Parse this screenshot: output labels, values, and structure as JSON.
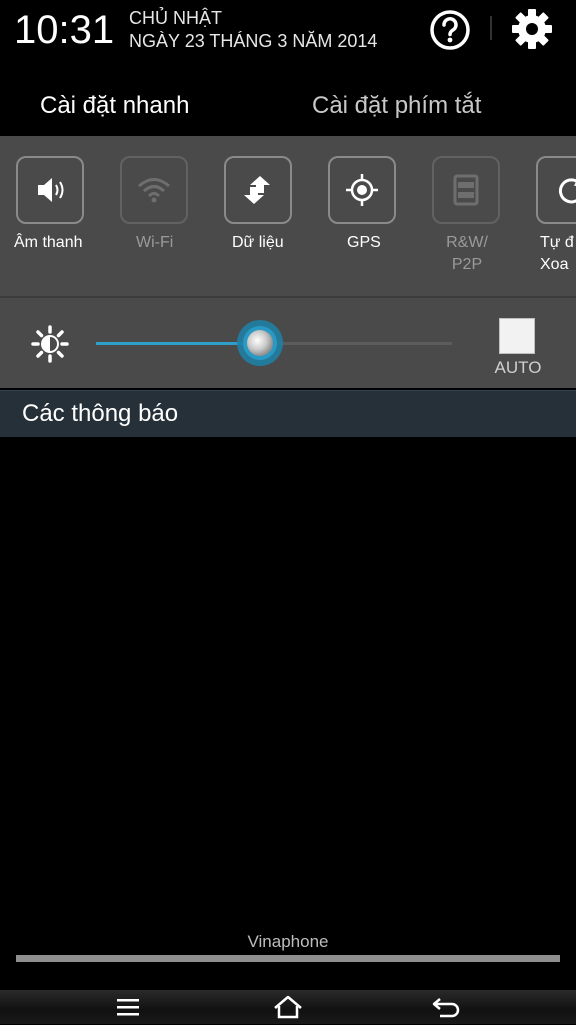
{
  "status": {
    "time": "10:31",
    "day": "CHỦ NHẬT",
    "date": "NGÀY 23 THÁNG 3 NĂM 2014",
    "help_icon": "help-circle-icon",
    "settings_icon": "gear-icon"
  },
  "tabs": [
    {
      "label": "Cài đặt nhanh",
      "active": true
    },
    {
      "label": "Cài đặt phím tắt",
      "active": false
    }
  ],
  "quick_settings": [
    {
      "label": "Âm thanh",
      "icon": "speaker-icon",
      "enabled": true
    },
    {
      "label": "Wi-Fi",
      "icon": "wifi-icon",
      "enabled": false
    },
    {
      "label": "Dữ liệu",
      "icon": "data-transfer-icon",
      "enabled": true
    },
    {
      "label": "GPS",
      "icon": "gps-icon",
      "enabled": true
    },
    {
      "label": "R&W/\nP2P",
      "icon": "rw-p2p-icon",
      "enabled": false
    },
    {
      "label": "Tự đ\nXoa",
      "icon": "rotate-icon",
      "enabled": true
    }
  ],
  "brightness": {
    "icon": "brightness-icon",
    "level": 0.46,
    "auto_label": "AUTO",
    "auto_checked": false
  },
  "notifications": {
    "title": "Các thông báo"
  },
  "carrier": "Vinaphone",
  "nav": {
    "menu_icon": "menu-icon",
    "home_icon": "home-icon",
    "back_icon": "back-icon"
  },
  "colors": {
    "accent": "#2f9fc7",
    "panel": "#4a4a4a",
    "notif_header": "#253038"
  }
}
